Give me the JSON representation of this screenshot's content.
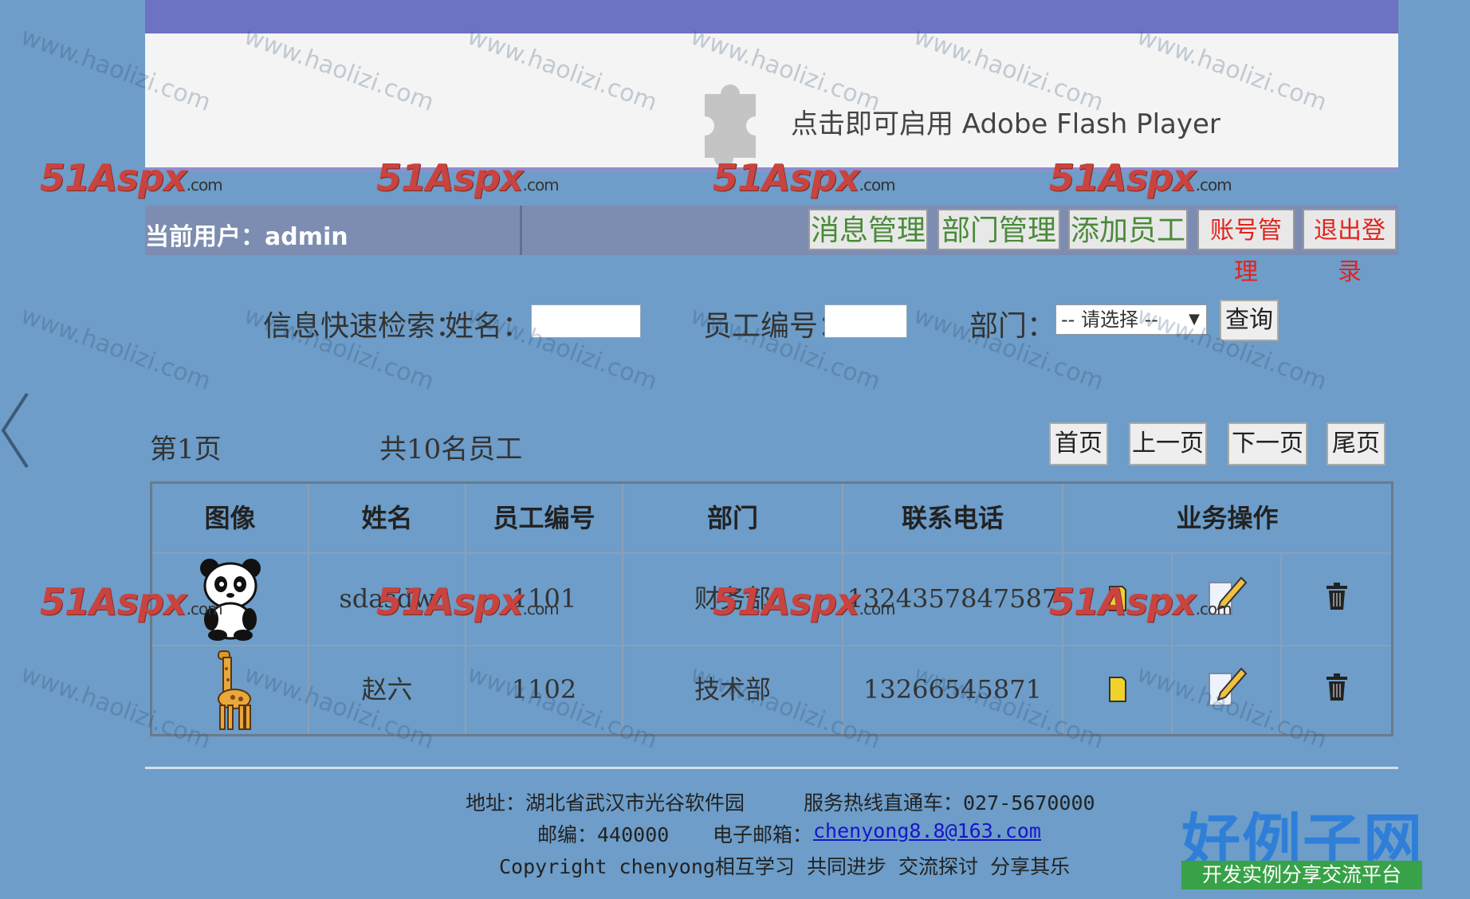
{
  "flash": {
    "message": "点击即可启用 Adobe Flash Player"
  },
  "watermark_logo": {
    "main": "51Aspx",
    "suffix": ".com"
  },
  "watermark_text": "www.haolizi.com",
  "userbar": {
    "current_user": "当前用户：admin"
  },
  "nav": [
    {
      "label": "消息管理",
      "color": "#4a8a3a"
    },
    {
      "label": "部门管理",
      "color": "#4a8a3a"
    },
    {
      "label": "添加员工",
      "color": "#4a8a3a"
    },
    {
      "label": "账号管理",
      "color": "#e0241e"
    },
    {
      "label": "退出登录",
      "color": "#e0241e"
    }
  ],
  "search": {
    "title": "信息快速检索：",
    "name_label": "姓名：",
    "name_value": "",
    "id_label": "员工编号：",
    "id_value": "",
    "dept_label": "部门：",
    "dept_selected": "-- 请选择 --",
    "query_button": "查询"
  },
  "paging": {
    "page": "第1页",
    "total": "共10名员工",
    "first": "首页",
    "prev": "上一页",
    "next": "下一页",
    "last": "尾页"
  },
  "table": {
    "headers": [
      "图像",
      "姓名",
      "员工编号",
      "部门",
      "联系电话",
      "业务操作"
    ],
    "rows": [
      {
        "avatar": "panda-icon",
        "name": "sdasdw",
        "id": "1101",
        "dept": "财务部",
        "phone": "1324357847587"
      },
      {
        "avatar": "giraffe-icon",
        "name": "赵六",
        "id": "1102",
        "dept": "技术部",
        "phone": "13266545871"
      }
    ]
  },
  "footer": {
    "address": "地址：湖北省武汉市光谷软件园",
    "hotline": "服务热线直通车：027-5670000",
    "postcode": "邮编：440000",
    "email_label": "电子邮箱：",
    "email": "chenyong8.8@163.com",
    "copyright": "Copyright chenyong相互学习 共同进步 交流探讨 分享其乐"
  },
  "brand": {
    "title": "好例子网",
    "tagline": "开发实例分享交流平台"
  },
  "colors": {
    "background": "#6d9dc8",
    "banner": "#6d72c2",
    "userbar": "#7d8db2",
    "brand_blue": "#2f7fd8",
    "brand_green": "#37a247"
  }
}
